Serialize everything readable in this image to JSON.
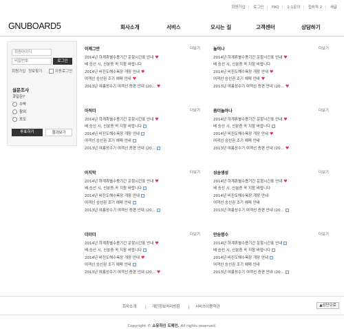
{
  "topbar": {
    "links": [
      "회원가입",
      "로그인",
      "FAQ",
      "1:1문의",
      "접속자 2",
      "새글"
    ]
  },
  "logo": "GNUBOARD5",
  "nav": [
    "회사소개",
    "서비스",
    "오시는 길",
    "고객센터",
    "상담하기"
  ],
  "login": {
    "id_placeholder": "회원아이디",
    "pw_placeholder": "비밀번호",
    "login_button": "로그인",
    "signup": "회원가입",
    "find_info": "정보찾기",
    "auto_login": "자동로그인"
  },
  "poll": {
    "title": "설문조사",
    "question": "과일은?",
    "options": [
      "수박",
      "참외",
      "포도"
    ],
    "vote_button": "투표하기",
    "result_button": "결과보기"
  },
  "boards": [
    {
      "title": "이제그만",
      "more": "더보기",
      "items": [
        "2014년 하계휴별수용기간 운항시간표 안내",
        "배 승선 시, 신분증 꼭 지참 바랍니다",
        "2014년 비진도해수욕장 개장 안내",
        "여객선 승선권 조기 예매 안내",
        "2013년 여름성수기 여객선 증편 안내 (20..."
      ],
      "icons": [
        "heart",
        "none",
        "heart",
        "heart",
        "heart"
      ]
    },
    {
      "title": "놀이나",
      "more": "더보기",
      "items": [
        "2014년 하계휴별수용기간 운항시간표 안내",
        "배 승선 시, 신분증 꼭 지참 바랍니다",
        "2014년 비진도해수욕장 개장 안내",
        "여객선 승선권 조기 예매 안내",
        "2013년 여름성수기 여객선 증편 안내 (20..."
      ],
      "icons": [
        "heart",
        "none",
        "heart",
        "heart",
        "heart"
      ]
    },
    {
      "title": "아직더",
      "more": "더보기",
      "items": [
        "2014년 하계휴별수용기간 운항시간표 안내",
        "배 승선 시, 신분증 꼭 지참 바랍니다",
        "2014년 비진도해수욕장 개장 안내",
        "여객선 승선권 조기 예매 안내",
        "2013년 여름성수기 여객선 증편 안내 (20..."
      ],
      "icons": [
        "heart",
        "img",
        "img",
        "img",
        "img"
      ]
    },
    {
      "title": "좀더놀아나",
      "more": "더보기",
      "items": [
        "2014년 하계휴별수용기간 운항시간표 안내",
        "배 승선 시, 신분증 꼭 지참 바랍니다",
        "2014년 비진도해수욕장 개장 안내",
        "여객선 승선권 조기 예매 안내",
        "2013년 여름성수기 여객선 증편 안내 (20..."
      ],
      "icons": [
        "heart",
        "img",
        "heart",
        "none",
        "heart"
      ]
    },
    {
      "title": "아지막",
      "more": "더보기",
      "items": [
        "2014년 하계휴별수용기간 운항시간표 안내",
        "배 승선 시, 신분증 꼭 지참 바랍니다",
        "2014년 비진도해수욕장 개장 안내",
        "여객선 승선권 조기 예매 안내",
        "2013년 여름성수기 여객선 증편 안내 (20..."
      ],
      "icons": [
        "heart",
        "img",
        "img",
        "img",
        "img"
      ]
    },
    {
      "title": "싱숭생성",
      "more": "더보기",
      "items": [
        "2014년 하계휴별수용기간 운항시간표 안내",
        "배 승선 시, 신분증 꼭 지참 바랍니다",
        "2014년 비진도해수욕장 개장 안내",
        "여객선 승선권 조기 예매 안내",
        "2013년 여름성수기 여객선 증편 안내 (20..."
      ],
      "icons": [
        "heart",
        "none",
        "none",
        "none",
        "img"
      ]
    },
    {
      "title": "더더더",
      "more": "더보기",
      "items": [
        "2014년 하계휴별수용기간 운항시간표 안내",
        "배 승선 시, 신분증 꼭 지참 바랍니다",
        "2014년 비진도해수욕장 개장 안내",
        "여객선 승선권 조기 예매 안내",
        "2013년 여름성수기 여객선 증편 안내 (20..."
      ],
      "icons": [
        "heart",
        "img",
        "heart",
        "img",
        "heart"
      ]
    },
    {
      "title": "만승명수",
      "more": "더보기",
      "items": [
        "2014년 하계휴별수용기간 운항시간표 안내",
        "배 승선 시, 신분증 꼭 지참 바랍니다",
        "2014년 비진도해수욕장 개장 안내",
        "여객선 승선권 조기 예매 안내",
        "2013년 여름성수기 여객선 증편 안내 (20..."
      ],
      "icons": [
        "img",
        "img",
        "img",
        "none",
        "img"
      ]
    }
  ],
  "footer": {
    "links": [
      "회사소개",
      "개인정보처리방침",
      "서비스이용약관"
    ],
    "top_button": "▲상단으로",
    "copyright_prefix": "Copyright ©",
    "copyright_domain": "소유하신 도메인.",
    "copyright_suffix": "All rights reserved."
  }
}
